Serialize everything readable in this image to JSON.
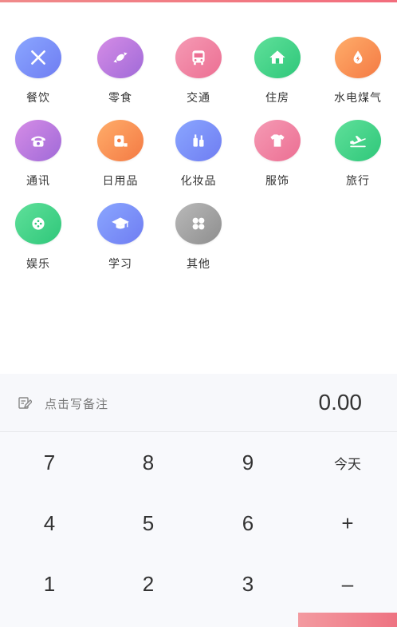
{
  "categories": [
    {
      "label": "餐饮",
      "icon": "utensils-icon",
      "gradient": "g-blue"
    },
    {
      "label": "零食",
      "icon": "candy-icon",
      "gradient": "g-purple"
    },
    {
      "label": "交通",
      "icon": "bus-icon",
      "gradient": "g-pink"
    },
    {
      "label": "住房",
      "icon": "house-icon",
      "gradient": "g-green"
    },
    {
      "label": "水电煤气",
      "icon": "water-drop-icon",
      "gradient": "g-orange"
    },
    {
      "label": "通讯",
      "icon": "telephone-icon",
      "gradient": "g-purple"
    },
    {
      "label": "日用品",
      "icon": "tissue-roll-icon",
      "gradient": "g-orange"
    },
    {
      "label": "化妆品",
      "icon": "cosmetics-icon",
      "gradient": "g-blue"
    },
    {
      "label": "服饰",
      "icon": "tshirt-icon",
      "gradient": "g-pink"
    },
    {
      "label": "旅行",
      "icon": "airplane-icon",
      "gradient": "g-green"
    },
    {
      "label": "娱乐",
      "icon": "gamepad-icon",
      "gradient": "g-green"
    },
    {
      "label": "学习",
      "icon": "graduation-cap-icon",
      "gradient": "g-blue"
    },
    {
      "label": "其他",
      "icon": "clover-icon",
      "gradient": "g-gray"
    }
  ],
  "note": {
    "placeholder": "点击写备注",
    "icon": "edit-note-icon"
  },
  "amount": "0.00",
  "keypad": {
    "k7": "7",
    "k8": "8",
    "k9": "9",
    "today": "今天",
    "k4": "4",
    "k5": "5",
    "k6": "6",
    "plus": "+",
    "k1": "1",
    "k2": "2",
    "k3": "3",
    "minus": "–"
  },
  "colors": {
    "accent": "#ee7382"
  }
}
